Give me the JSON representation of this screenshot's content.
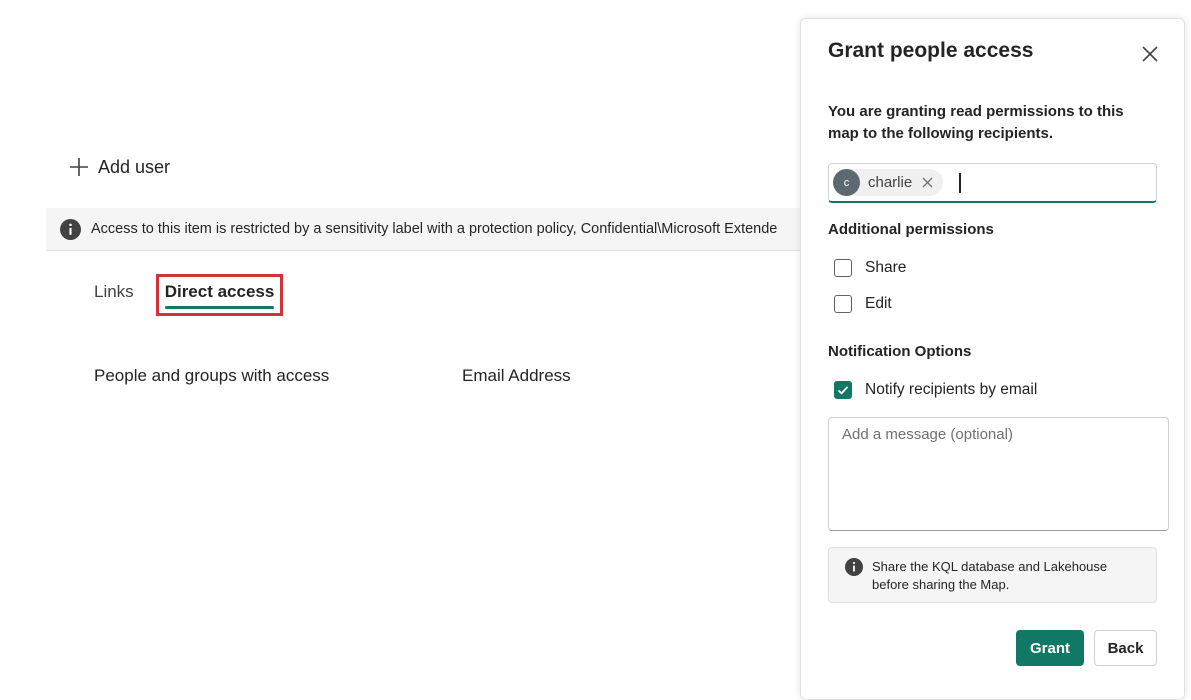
{
  "page": {
    "add_user_label": "Add user",
    "info_banner": "Access to this item is restricted by a sensitivity label with a protection policy, Confidential\\Microsoft Extende",
    "tabs": [
      {
        "label": "Links",
        "active": false
      },
      {
        "label": "Direct access",
        "active": true
      }
    ],
    "columns": [
      "People and groups with access",
      "Email Address"
    ]
  },
  "panel": {
    "title": "Grant people access",
    "intro": "You are granting read permissions to this map to the following recipients.",
    "recipient": {
      "initial": "c",
      "name": "charlie"
    },
    "additional_permissions_label": "Additional permissions",
    "permissions": [
      {
        "label": "Share",
        "checked": false
      },
      {
        "label": "Edit",
        "checked": false
      }
    ],
    "notification_label": "Notification Options",
    "notify": {
      "label": "Notify recipients by email",
      "checked": true
    },
    "message_placeholder": "Add a message (optional)",
    "notice": "Share the KQL database and Lakehouse before sharing the Map.",
    "grant_label": "Grant",
    "back_label": "Back"
  },
  "colors": {
    "accent": "#117865",
    "highlight_border": "#d13438"
  },
  "icons": [
    "plus-icon",
    "info-icon",
    "close-icon",
    "checkmark-icon"
  ]
}
